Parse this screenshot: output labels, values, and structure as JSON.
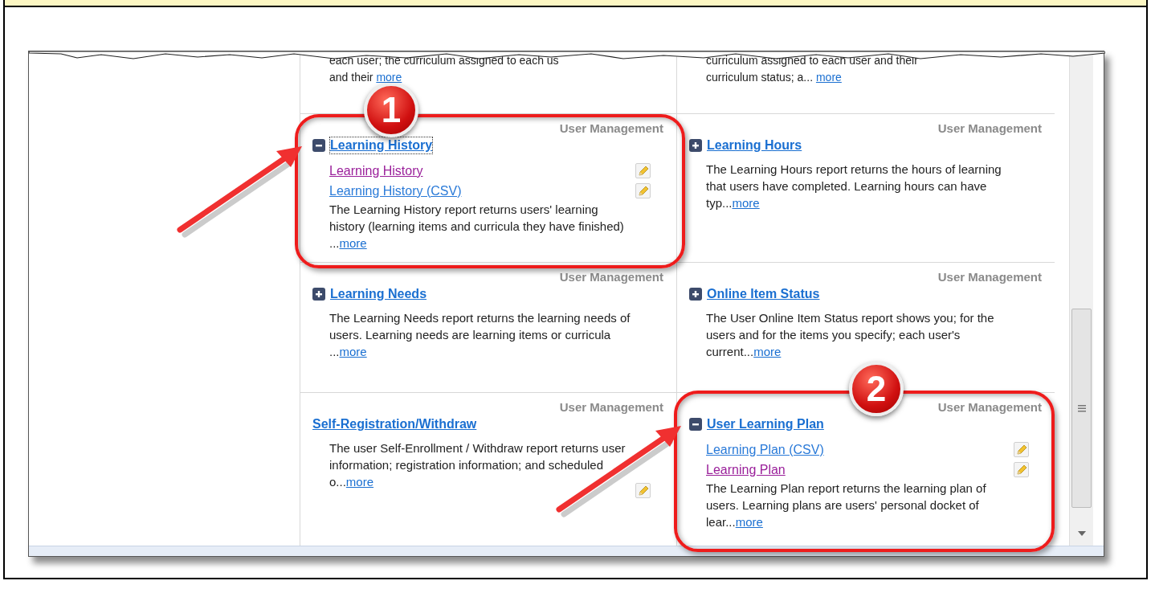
{
  "top_row": [
    {
      "lines": [
        "each user; the curriculum assigned to each us",
        "and their"
      ],
      "more": "more"
    },
    {
      "lines": [
        "curriculum assigned to each user and their",
        "curriculum status; a..."
      ],
      "more": "more"
    }
  ],
  "reports": [
    {
      "category": "User Management",
      "title": "Learning History",
      "expanded": true,
      "focused": true,
      "links": [
        {
          "label": "Learning History",
          "visited": true
        },
        {
          "label": "Learning History (CSV)",
          "visited": false
        }
      ],
      "description": "The Learning History report returns users' learning history (learning items and curricula they have finished) ...",
      "more": "more"
    },
    {
      "category": "User Management",
      "title": "Learning Hours",
      "expanded": false,
      "description": "The Learning Hours report returns the hours of learning that users have completed. Learning hours can have typ...",
      "more": "more"
    },
    {
      "category": "User Management",
      "title": "Learning Needs",
      "expanded": false,
      "description": "The Learning Needs report returns the learning needs of users. Learning needs are learning items or curricula ...",
      "more": "more"
    },
    {
      "category": "User Management",
      "title": "Online Item Status",
      "expanded": false,
      "description": "The User Online Item Status report shows you; for the users and for the items you specify; each user's current...",
      "more": "more"
    },
    {
      "category": "User Management",
      "title": "Self-Registration/Withdraw",
      "description": "The user Self-Enrollment / Withdraw report returns user information; registration information; and scheduled o...",
      "more": "more",
      "edit_icon": true
    },
    {
      "category": "User Management",
      "title": "User Learning Plan",
      "expanded": true,
      "links": [
        {
          "label": "Learning Plan (CSV)",
          "visited": false
        },
        {
          "label": "Learning Plan",
          "visited": true
        }
      ],
      "description": "The Learning Plan report returns the learning plan of users. Learning plans are users' personal docket of lear...",
      "more": "more"
    }
  ],
  "annotations": [
    {
      "number": "1"
    },
    {
      "number": "2"
    }
  ]
}
